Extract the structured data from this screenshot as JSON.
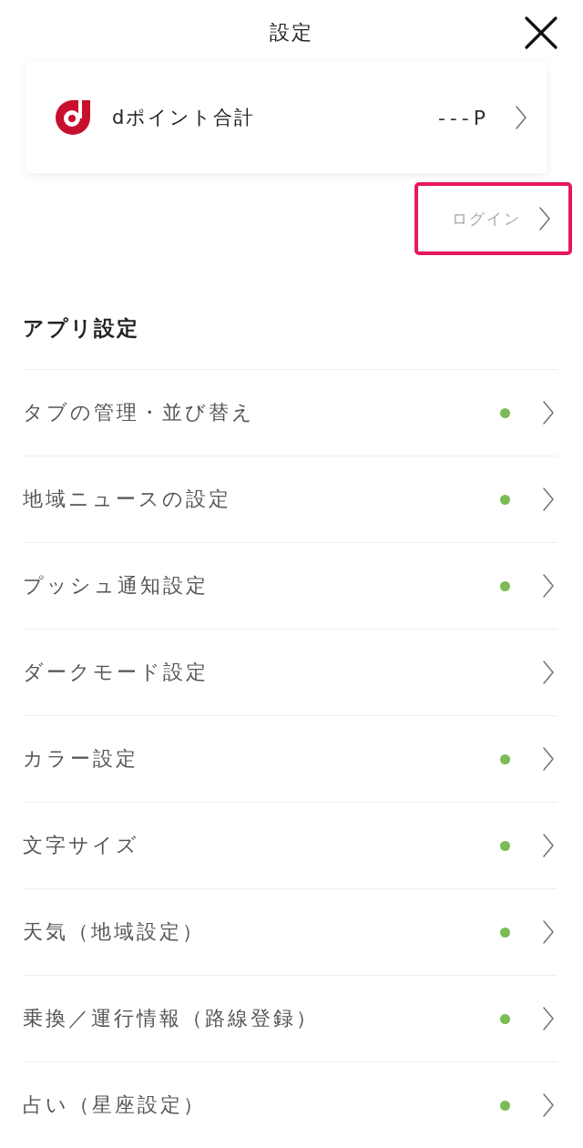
{
  "header": {
    "title": "設定"
  },
  "points_card": {
    "label": "dポイント合計",
    "value": "---P"
  },
  "login": {
    "label": "ログイン",
    "highlighted": true
  },
  "section": {
    "title": "アプリ設定"
  },
  "items": [
    {
      "label": "タブの管理・並び替え",
      "dot": true
    },
    {
      "label": "地域ニュースの設定",
      "dot": true
    },
    {
      "label": "プッシュ通知設定",
      "dot": true
    },
    {
      "label": "ダークモード設定",
      "dot": false
    },
    {
      "label": "カラー設定",
      "dot": true
    },
    {
      "label": "文字サイズ",
      "dot": true
    },
    {
      "label": "天気（地域設定）",
      "dot": true
    },
    {
      "label": "乗換／運行情報（路線登録）",
      "dot": true
    },
    {
      "label": "占い（星座設定）",
      "dot": true
    }
  ]
}
